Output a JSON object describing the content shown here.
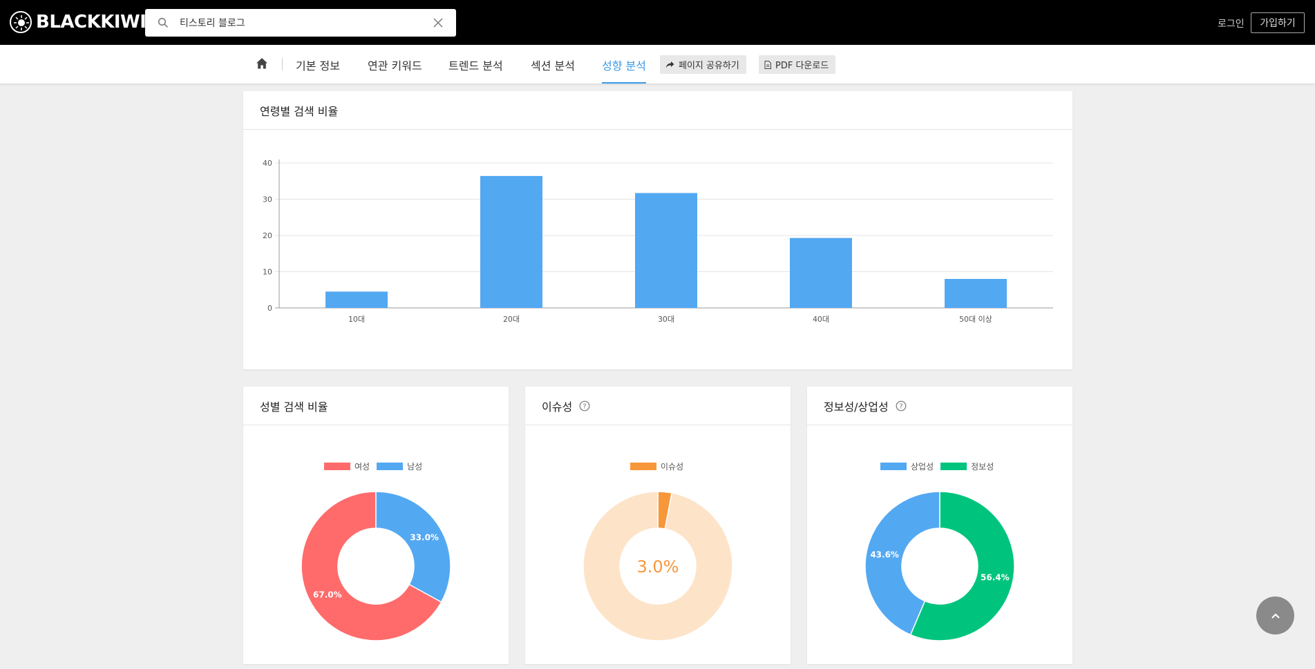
{
  "header": {
    "logo_text": "BLACKKIWI",
    "search_value": "티스토리 블로그",
    "login": "로그인",
    "join": "가입하기"
  },
  "nav": {
    "tabs": [
      {
        "label": "기본 정보",
        "active": false
      },
      {
        "label": "연관 키워드",
        "active": false
      },
      {
        "label": "트렌드 분석",
        "active": false
      },
      {
        "label": "섹션 분석",
        "active": false
      },
      {
        "label": "성향 분석",
        "active": true
      }
    ],
    "share": "페이지 공유하기",
    "pdf": "PDF 다운로드"
  },
  "age_card": {
    "title": "연령별 검색 비율"
  },
  "gender_card": {
    "title": "성별 검색 비율"
  },
  "issue_card": {
    "title": "이슈성",
    "center_label": "3.0%"
  },
  "info_card": {
    "title": "정보성/상업성"
  },
  "colors": {
    "accent": "#3a9ae8",
    "bar": "#53a8f2",
    "female": "#ff6b6b",
    "male": "#53a8f2",
    "issue": "#f7973a",
    "issue_bg": "#fde3c8",
    "commercial": "#53a8f2",
    "informational": "#00c47e"
  },
  "chart_data": [
    {
      "type": "bar",
      "title": "연령별 검색 비율",
      "categories": [
        "10대",
        "20대",
        "30대",
        "40대",
        "50대 이상"
      ],
      "values": [
        4.5,
        36.4,
        31.7,
        19.3,
        8.0
      ],
      "ylim": [
        0,
        40
      ],
      "yticks": [
        0,
        10,
        20,
        30,
        40
      ],
      "grid": true
    },
    {
      "type": "pie",
      "title": "성별 검색 비율",
      "legend": [
        "여성",
        "남성"
      ],
      "slices": [
        {
          "name": "여성",
          "value": 67.0,
          "label": "67.0%"
        },
        {
          "name": "남성",
          "value": 33.0,
          "label": "33.0%"
        }
      ],
      "legend_placement": "top"
    },
    {
      "type": "pie",
      "title": "이슈성",
      "legend": [
        "이슈성"
      ],
      "slices": [
        {
          "name": "이슈성",
          "value": 3.0
        },
        {
          "name": "",
          "value": 97.0
        }
      ],
      "legend_placement": "top"
    },
    {
      "type": "pie",
      "title": "정보성/상업성",
      "legend": [
        "상업성",
        "정보성"
      ],
      "slices": [
        {
          "name": "상업성",
          "value": 43.6,
          "label": "43.6%"
        },
        {
          "name": "정보성",
          "value": 56.4,
          "label": "56.4%"
        }
      ],
      "legend_placement": "top"
    }
  ]
}
